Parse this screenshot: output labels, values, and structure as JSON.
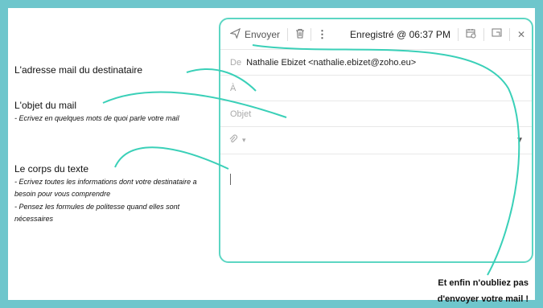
{
  "annotations": {
    "recipient": "L'adresse mail du destinataire",
    "subject_title": "L'objet du mail",
    "subject_hint": "- Ecrivez en quelques mots de quoi parle votre mail",
    "body_title": "Le corps du texte",
    "body_hint_1": "- Ecrivez toutes les informations dont votre destinataire a besoin pour vous comprendre",
    "body_hint_2": "- Pensez les formules de politesse quand elles sont nécessaires",
    "final_line_1": "Et enfin  n'oubliez pas",
    "final_line_2": "d'envoyer votre mail !"
  },
  "toolbar": {
    "send_label": "Envoyer",
    "saved_status": "Enregistré @ 06:37 PM",
    "icons": [
      "paper-plane-icon",
      "trash-icon",
      "more-vertical-icon",
      "calendar-clock-icon",
      "minimize-window-icon",
      "close-icon"
    ]
  },
  "compose": {
    "from_label": "De",
    "from_value": "Nathalie Ebizet <nathalie.ebizet@zoho.eu>",
    "to_label": "À",
    "subject_placeholder": "Objet",
    "attach_icon": "paperclip-icon",
    "attach_dropdown": "chevron-down-icon",
    "body_value": ""
  },
  "colors": {
    "background": "#6ec6cc",
    "accent": "#5cd6c3"
  }
}
